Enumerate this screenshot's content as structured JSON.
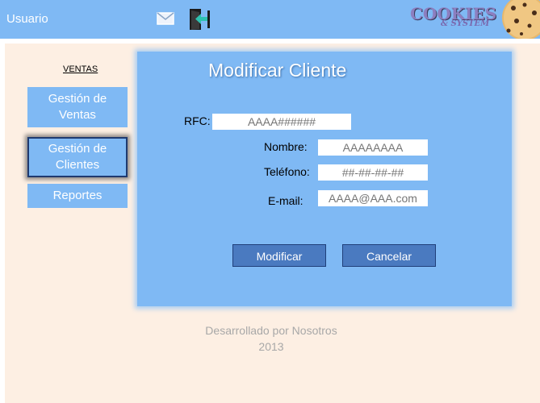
{
  "header": {
    "user_label": "Usuario",
    "mail_icon": "mail-icon",
    "exit_icon": "exit-door-icon",
    "logo_main": "COOKIES",
    "logo_sub": "& SYSTEM",
    "color": "#7fb9f4"
  },
  "sidebar": {
    "section_label": "VENTAS",
    "items": [
      {
        "label_line1": "Gestión de",
        "label_line2": "Ventas",
        "active": false
      },
      {
        "label_line1": "Gestión de",
        "label_line2": "Clientes",
        "active": true
      },
      {
        "label": "Reportes",
        "active": false
      }
    ]
  },
  "panel": {
    "title": "Modificar Cliente",
    "fields": {
      "rfc": {
        "label": "RFC:",
        "placeholder": "AAAA######"
      },
      "nombre": {
        "label": "Nombre:",
        "placeholder": "AAAAAAAA"
      },
      "telefono": {
        "label": "Teléfono:",
        "placeholder": "##-##-##-##"
      },
      "email": {
        "label": "E-mail:",
        "placeholder": "AAAA@AAA.com"
      }
    },
    "buttons": {
      "modificar": "Modificar",
      "cancelar": "Cancelar"
    }
  },
  "footer": {
    "line1": "Desarrollado por Nosotros",
    "line2": "2013"
  },
  "colors": {
    "background": "#fdefe3",
    "accent": "#7fb9f4",
    "button_dark": "#4a7ac0"
  }
}
